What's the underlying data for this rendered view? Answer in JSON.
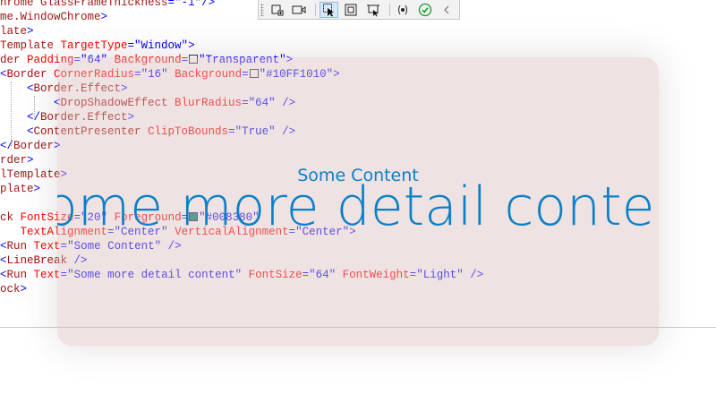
{
  "code_lines": [
    {
      "parts": [
        {
          "c": "tag",
          "t": "hrome GlassFrameThickness"
        },
        {
          "c": "pun",
          "t": "="
        },
        {
          "c": "str",
          "t": "\"-1\""
        },
        {
          "c": "pun",
          "t": "/>"
        }
      ]
    },
    {
      "parts": [
        {
          "c": "tag",
          "t": "me.WindowChrome"
        },
        {
          "c": "pun",
          "t": ">"
        }
      ]
    },
    {
      "parts": [
        {
          "c": "tag",
          "t": "late"
        },
        {
          "c": "pun",
          "t": ">"
        }
      ]
    },
    {
      "parts": [
        {
          "c": "tag",
          "t": "Template"
        },
        {
          "c": "attr",
          "t": " TargetType"
        },
        {
          "c": "pun",
          "t": "="
        },
        {
          "c": "str",
          "t": "\"Window\""
        },
        {
          "c": "pun",
          "t": ">"
        }
      ]
    },
    {
      "parts": [
        {
          "c": "tag",
          "t": "der"
        },
        {
          "c": "attr",
          "t": " Padding"
        },
        {
          "c": "pun",
          "t": "="
        },
        {
          "c": "str",
          "t": "\"64\""
        },
        {
          "c": "attr",
          "t": " Background"
        },
        {
          "c": "pun",
          "t": "="
        },
        {
          "c": "sw",
          "t": ""
        },
        {
          "c": "str",
          "t": "\"Transparent\""
        },
        {
          "c": "pun",
          "t": ">"
        }
      ]
    },
    {
      "parts": [
        {
          "c": "pun",
          "t": "<"
        },
        {
          "c": "tag",
          "t": "Border"
        },
        {
          "c": "attr",
          "t": " CornerRadius"
        },
        {
          "c": "pun",
          "t": "="
        },
        {
          "c": "str",
          "t": "\"16\""
        },
        {
          "c": "attr",
          "t": " Background"
        },
        {
          "c": "pun",
          "t": "="
        },
        {
          "c": "sw",
          "t": ""
        },
        {
          "c": "str",
          "t": "\"#10FF1010\""
        },
        {
          "c": "pun",
          "t": ">"
        }
      ]
    },
    {
      "parts": [
        {
          "c": "pun",
          "t": "    <"
        },
        {
          "c": "tag",
          "t": "Border.Effect"
        },
        {
          "c": "pun",
          "t": ">"
        }
      ]
    },
    {
      "parts": [
        {
          "c": "pun",
          "t": "        <"
        },
        {
          "c": "tag",
          "t": "DropShadowEffect"
        },
        {
          "c": "attr",
          "t": " BlurRadius"
        },
        {
          "c": "pun",
          "t": "="
        },
        {
          "c": "str",
          "t": "\"64\""
        },
        {
          "c": "pun",
          "t": " />"
        }
      ]
    },
    {
      "parts": [
        {
          "c": "pun",
          "t": "    </"
        },
        {
          "c": "tag",
          "t": "Border.Effect"
        },
        {
          "c": "pun",
          "t": ">"
        }
      ]
    },
    {
      "parts": [
        {
          "c": "pun",
          "t": "    <"
        },
        {
          "c": "tag",
          "t": "ContentPresenter"
        },
        {
          "c": "attr",
          "t": " ClipToBounds"
        },
        {
          "c": "pun",
          "t": "="
        },
        {
          "c": "str",
          "t": "\"True\""
        },
        {
          "c": "pun",
          "t": " />"
        }
      ]
    },
    {
      "parts": [
        {
          "c": "pun",
          "t": "</"
        },
        {
          "c": "tag",
          "t": "Border"
        },
        {
          "c": "pun",
          "t": ">"
        }
      ]
    },
    {
      "parts": [
        {
          "c": "tag",
          "t": "rder"
        },
        {
          "c": "pun",
          "t": ">"
        }
      ]
    },
    {
      "parts": [
        {
          "c": "tag",
          "t": "lTemplate"
        },
        {
          "c": "pun",
          "t": ">"
        }
      ]
    },
    {
      "parts": [
        {
          "c": "tag",
          "t": "plate"
        },
        {
          "c": "pun",
          "t": ">"
        }
      ]
    },
    {
      "parts": []
    },
    {
      "parts": [
        {
          "c": "tag",
          "t": "ck"
        },
        {
          "c": "attr",
          "t": " FontSize"
        },
        {
          "c": "pun",
          "t": "="
        },
        {
          "c": "str",
          "t": "\"20\""
        },
        {
          "c": "attr",
          "t": " Foreground"
        },
        {
          "c": "pun",
          "t": "="
        },
        {
          "c": "sw2",
          "t": ""
        },
        {
          "c": "str",
          "t": "\"#008380\""
        }
      ]
    },
    {
      "parts": [
        {
          "c": "attr",
          "t": "   TextAlignment"
        },
        {
          "c": "pun",
          "t": "="
        },
        {
          "c": "str",
          "t": "\"Center\""
        },
        {
          "c": "attr",
          "t": " VerticalAlignment"
        },
        {
          "c": "pun",
          "t": "="
        },
        {
          "c": "str",
          "t": "\"Center\""
        },
        {
          "c": "pun",
          "t": ">"
        }
      ]
    },
    {
      "parts": [
        {
          "c": "pun",
          "t": "<"
        },
        {
          "c": "tag",
          "t": "Run"
        },
        {
          "c": "attr",
          "t": " Text"
        },
        {
          "c": "pun",
          "t": "="
        },
        {
          "c": "str",
          "t": "\"Some Content\""
        },
        {
          "c": "pun",
          "t": " />"
        }
      ]
    },
    {
      "parts": [
        {
          "c": "pun",
          "t": "<"
        },
        {
          "c": "tag",
          "t": "LineBreak"
        },
        {
          "c": "pun",
          "t": " />"
        }
      ]
    },
    {
      "parts": [
        {
          "c": "pun",
          "t": "<"
        },
        {
          "c": "tag",
          "t": "Run"
        },
        {
          "c": "attr",
          "t": " Text"
        },
        {
          "c": "pun",
          "t": "="
        },
        {
          "c": "str",
          "t": "\"Some more detail content\""
        },
        {
          "c": "attr",
          "t": " FontSize"
        },
        {
          "c": "pun",
          "t": "="
        },
        {
          "c": "str",
          "t": "\"64\""
        },
        {
          "c": "attr",
          "t": " FontWeight"
        },
        {
          "c": "pun",
          "t": "="
        },
        {
          "c": "str",
          "t": "\"Light\""
        },
        {
          "c": "pun",
          "t": " />"
        }
      ]
    },
    {
      "parts": [
        {
          "c": "tag",
          "t": "ock"
        },
        {
          "c": "pun",
          "t": ">"
        }
      ]
    }
  ],
  "toolbar": {
    "buttons": [
      {
        "name": "select-element-icon",
        "active": false
      },
      {
        "name": "video-camera-icon",
        "active": false
      },
      {
        "name": "pointer-select-icon",
        "active": true
      },
      {
        "name": "focus-rectangle-icon",
        "active": false
      },
      {
        "name": "layout-adorner-icon",
        "active": false
      },
      {
        "name": "track-focus-icon",
        "active": false
      },
      {
        "name": "checkmark-icon",
        "active": false
      },
      {
        "name": "collapse-chevron-icon",
        "active": false
      }
    ]
  },
  "overlay": {
    "line1": "Some Content",
    "line2": "Some more detail content"
  },
  "colors": {
    "content_text": "#0a7fc9",
    "glass_tint": "#d6baba",
    "swatch_transparent": "#ffffff",
    "swatch_background": "#10FF1010",
    "swatch_foreground": "#008380"
  }
}
